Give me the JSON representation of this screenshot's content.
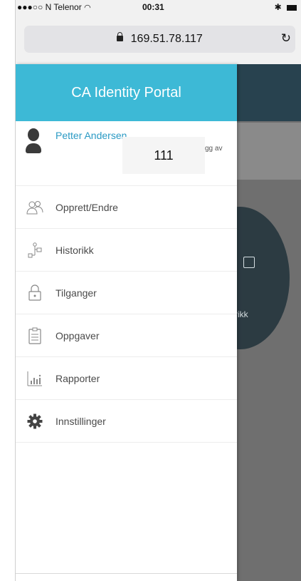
{
  "statusbar": {
    "carrier": "●●●○○ N Telenor",
    "time": "00:31"
  },
  "browser": {
    "url": "169.51.78.117",
    "reload_icon": "reload-icon"
  },
  "drawer": {
    "title": "CA Identity Portal",
    "user": {
      "name": "Petter Andersen",
      "logout_label": "gg av",
      "sticker": "111"
    },
    "menu": [
      {
        "label": "Opprett/Endre",
        "icon": "users-icon"
      },
      {
        "label": "Historikk",
        "icon": "history-icon"
      },
      {
        "label": "Tilganger",
        "icon": "lock-icon"
      },
      {
        "label": "Oppgaver",
        "icon": "tasks-icon"
      },
      {
        "label": "Rapporter",
        "icon": "reports-icon"
      },
      {
        "label": "Innstillinger",
        "icon": "gear-icon"
      }
    ]
  },
  "background": {
    "circle_label": "rikk"
  },
  "colors": {
    "accent": "#3db9d6",
    "user_name": "#2a9ac4",
    "header_dark": "#28424f"
  }
}
